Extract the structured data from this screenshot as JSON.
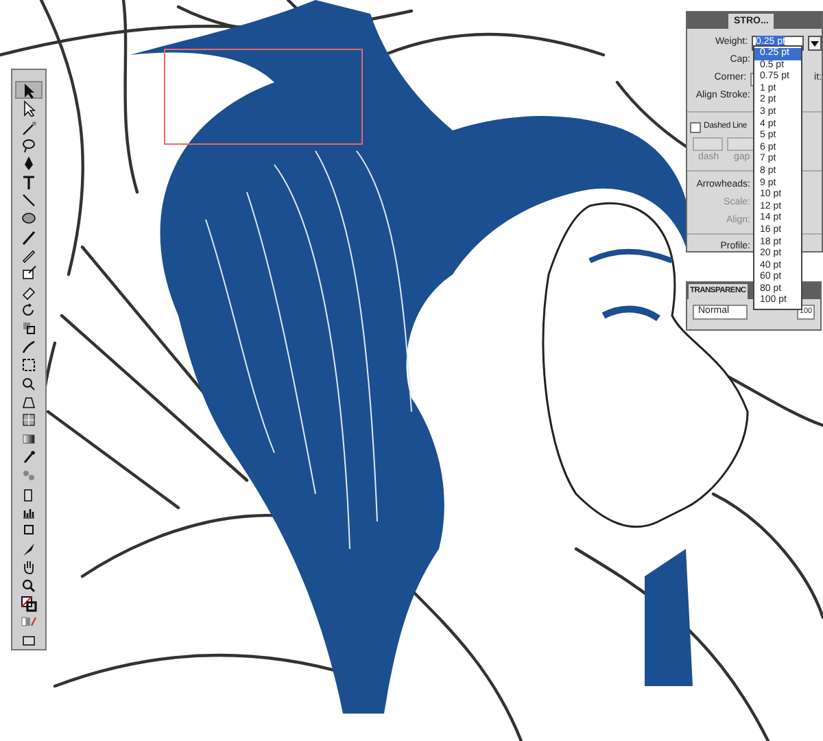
{
  "stroke_panel": {
    "title": "STRO...",
    "weight_label": "Weight:",
    "weight_value": "0.25 pt",
    "cap_label": "Cap:",
    "corner_label": "Corner:",
    "limit_label": "it:",
    "align_stroke_label": "Align Stroke:",
    "dashed_line": {
      "label": "Dashed Line",
      "checked": false
    },
    "dash_labels": [
      "dash",
      "gap"
    ],
    "arrowheads_label": "Arrowheads:",
    "scale_label": "Scale:",
    "align_label": "Align:",
    "profile_label": "Profile:"
  },
  "weight_dropdown": [
    {
      "label": "0.25 pt",
      "selected": true
    },
    {
      "label": "0.5 pt",
      "selected": false
    },
    {
      "label": "0.75 pt",
      "selected": false
    },
    {
      "label": "1 pt",
      "selected": false
    },
    {
      "label": "2 pt",
      "selected": false
    },
    {
      "label": "3 pt",
      "selected": false
    },
    {
      "label": "4 pt",
      "selected": false
    },
    {
      "label": "5 pt",
      "selected": false
    },
    {
      "label": "6 pt",
      "selected": false
    },
    {
      "label": "7 pt",
      "selected": false
    },
    {
      "label": "8 pt",
      "selected": false
    },
    {
      "label": "9 pt",
      "selected": false
    },
    {
      "label": "10 pt",
      "selected": false
    },
    {
      "label": "12 pt",
      "selected": false
    },
    {
      "label": "14 pt",
      "selected": false
    },
    {
      "label": "16 pt",
      "selected": false
    },
    {
      "label": "18 pt",
      "selected": false
    },
    {
      "label": "20 pt",
      "selected": false
    },
    {
      "label": "40 pt",
      "selected": false
    },
    {
      "label": "60 pt",
      "selected": false
    },
    {
      "label": "80 pt",
      "selected": false
    },
    {
      "label": "100 pt",
      "selected": false
    }
  ],
  "transparency_panel": {
    "title": "TRANSPARENC",
    "blend_mode": "Normal",
    "opacity_value": "100"
  }
}
